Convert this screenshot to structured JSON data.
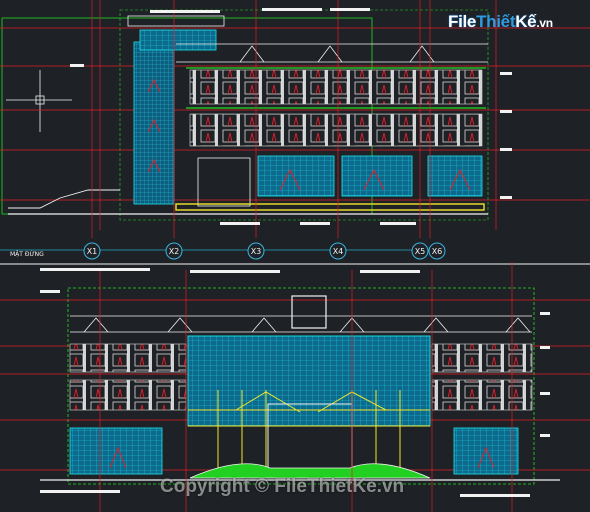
{
  "app": {
    "title": ""
  },
  "logo": {
    "part1": "File",
    "part2": "Thiết",
    "part3": "Kế",
    "part4": ".vn"
  },
  "watermark": {
    "text": "Copyright © FileThietKe.vn"
  },
  "drawing": {
    "upper_caption": "MẶT ĐỨNG",
    "axis_labels": [
      "X1",
      "X2",
      "X3",
      "X4",
      "X5",
      "X6"
    ]
  },
  "colors": {
    "background": "#1e2125",
    "axis_red": "#e0202a",
    "cyan": "#19e6f0",
    "glass_blue": "#0d6a8c",
    "yellow": "#f2e62a",
    "green": "#22dd22",
    "white": "#f2f2f2",
    "magenta": "#d03cd0"
  },
  "icons": [
    "crosshair-cursor-icon",
    "axis-bubble-icon"
  ]
}
